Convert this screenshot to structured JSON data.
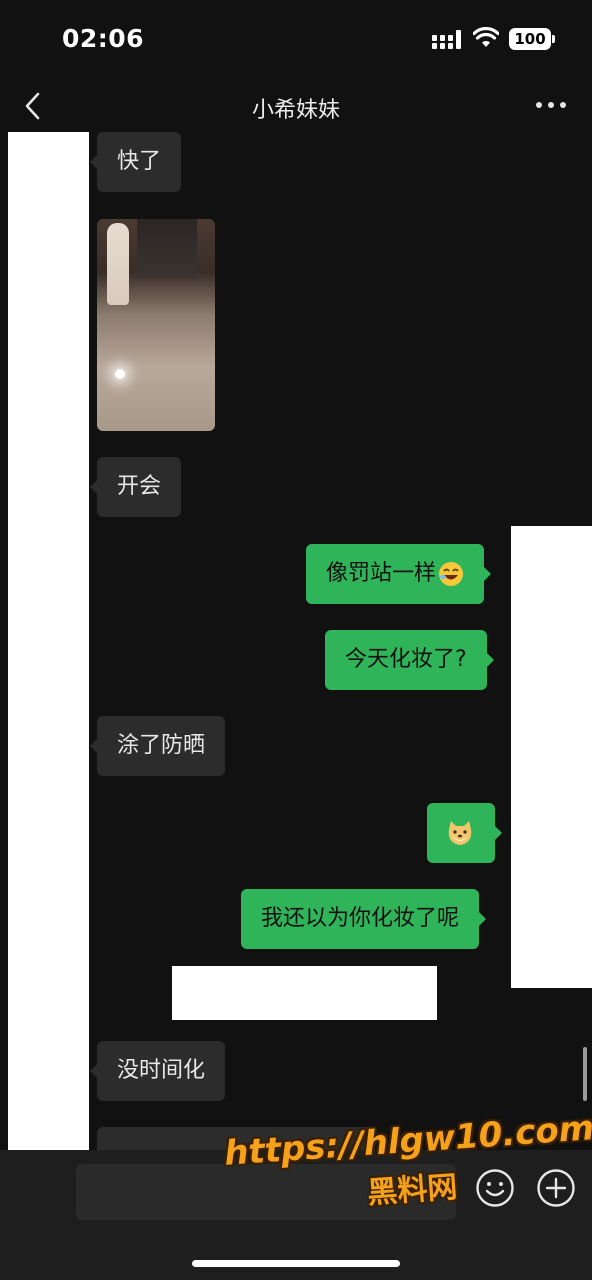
{
  "status": {
    "time": "02:06",
    "battery": "100"
  },
  "header": {
    "title": "小希妹妹",
    "back_icon": "chevron-left-icon",
    "more_icon": "more-dots-icon"
  },
  "messages": [
    {
      "side": "received",
      "text": "快了"
    },
    {
      "side": "received",
      "type": "image"
    },
    {
      "side": "received",
      "text": "开会"
    },
    {
      "side": "sent",
      "text": "像罚站一样",
      "emoji": "laughing-emoji"
    },
    {
      "side": "sent",
      "text": "今天化妆了?"
    },
    {
      "side": "received",
      "text": "涂了防晒"
    },
    {
      "side": "sent",
      "type": "sticker",
      "emoji": "doge-emoji"
    },
    {
      "side": "sent",
      "text": "我还以为你化妆了呢"
    },
    {
      "side": "received",
      "text": "没时间化"
    }
  ],
  "input_bar": {
    "emoji_icon": "smiley-icon",
    "plus_icon": "plus-circle-icon"
  },
  "watermark": {
    "url": "https://hlgw10.com",
    "name": "黑料网"
  }
}
